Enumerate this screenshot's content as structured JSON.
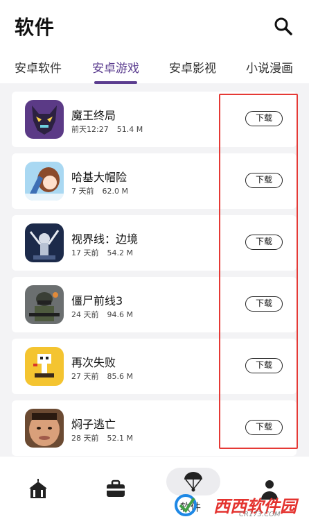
{
  "header": {
    "title": "软件"
  },
  "tabs": [
    {
      "label": "安卓软件",
      "active": false
    },
    {
      "label": "安卓游戏",
      "active": true
    },
    {
      "label": "安卓影视",
      "active": false
    },
    {
      "label": "小说漫画",
      "active": false
    }
  ],
  "apps": [
    {
      "name": "魔王终局",
      "time": "前天12:27",
      "size": "51.4 M",
      "button": "下载",
      "icon": "wolf-mask-game-icon"
    },
    {
      "name": "哈基大帽险",
      "time": "7 天前",
      "size": "62.0 M",
      "button": "下载",
      "icon": "anime-girl-game-icon"
    },
    {
      "name": "视界线：边境",
      "time": "17 天前",
      "size": "54.2 M",
      "button": "下载",
      "icon": "robot-mech-game-icon"
    },
    {
      "name": "僵尸前线3",
      "time": "24 天前",
      "size": "94.6 M",
      "button": "下载",
      "icon": "soldier-shooter-game-icon"
    },
    {
      "name": "再次失败",
      "time": "27 天前",
      "size": "85.6 M",
      "button": "下载",
      "icon": "pixel-character-game-icon"
    },
    {
      "name": "焖子逃亡",
      "time": "28 天前",
      "size": "52.1 M",
      "button": "下载",
      "icon": "man-face-game-icon"
    }
  ],
  "bottom_nav": {
    "items": [
      {
        "icon": "circus-tent-icon"
      },
      {
        "icon": "toolbox-icon"
      },
      {
        "icon": "parachute-icon",
        "label": "软件",
        "active": true
      },
      {
        "icon": "profile-icon"
      }
    ]
  },
  "watermark": {
    "text": "西西软件园",
    "sub": "CR173.COM"
  },
  "colors": {
    "accent": "#5b3d8f",
    "highlight": "#e53935",
    "background": "#f3f3f5"
  }
}
